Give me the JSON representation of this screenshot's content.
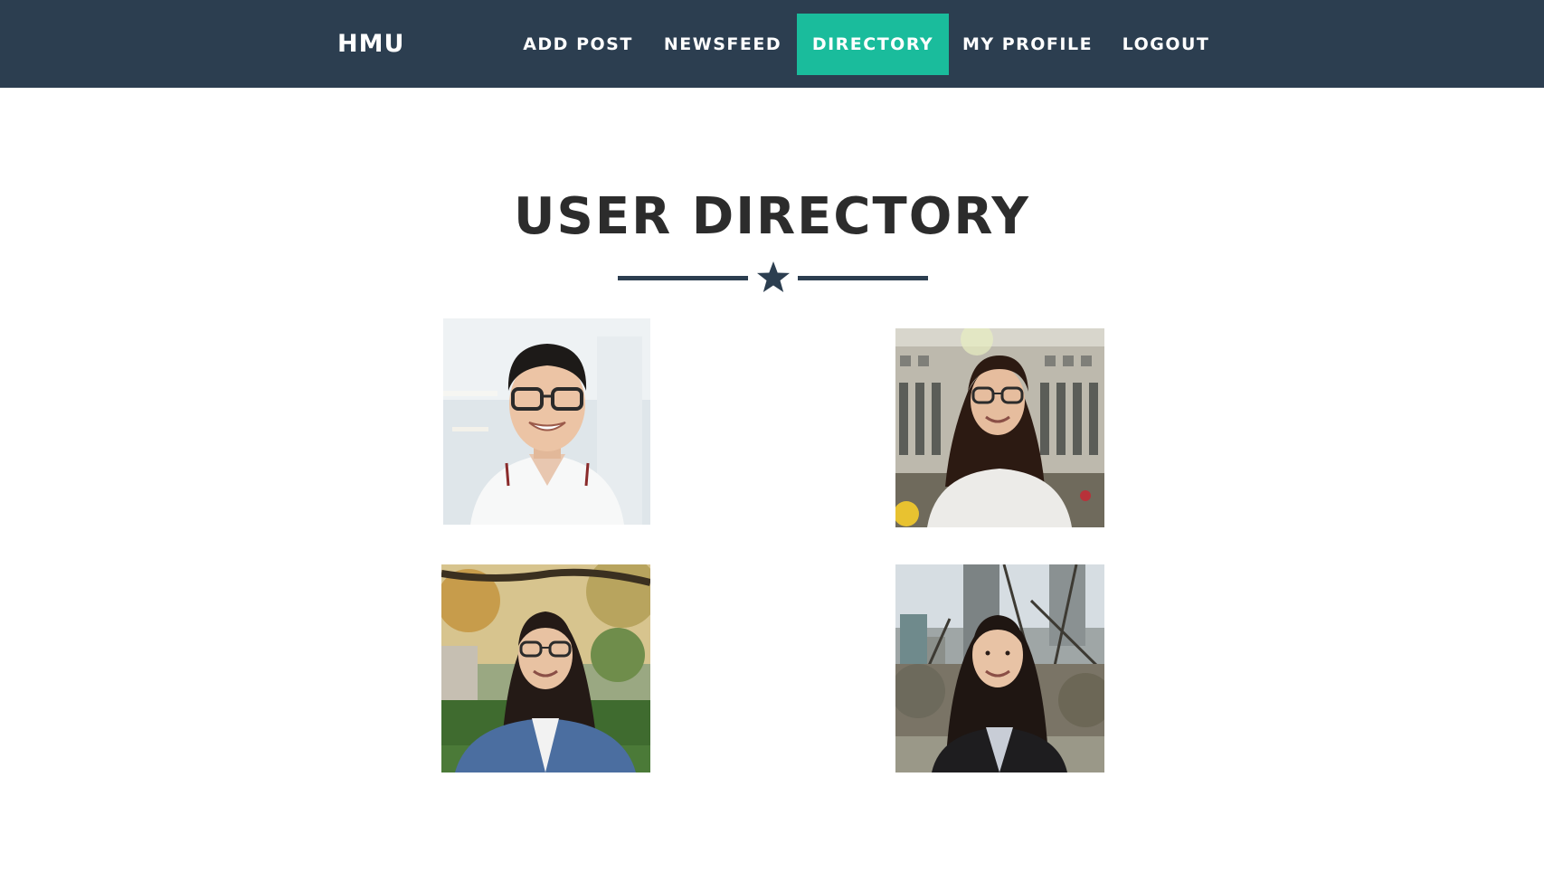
{
  "brand": "HMU",
  "nav": {
    "add_post": "ADD POST",
    "newsfeed": "NEWSFEED",
    "directory": "DIRECTORY",
    "my_profile": "MY PROFILE",
    "logout": "LOGOUT",
    "active": "directory"
  },
  "page_title": "USER DIRECTORY",
  "divider_icon": "star-icon",
  "colors": {
    "navbar_bg": "#2c3e50",
    "accent": "#1abc9c",
    "title_text": "#2c2c2c"
  },
  "directory": {
    "users": [
      {
        "photo": "user-photo-1"
      },
      {
        "photo": "user-photo-2"
      },
      {
        "photo": "user-photo-3"
      },
      {
        "photo": "user-photo-4"
      }
    ]
  }
}
